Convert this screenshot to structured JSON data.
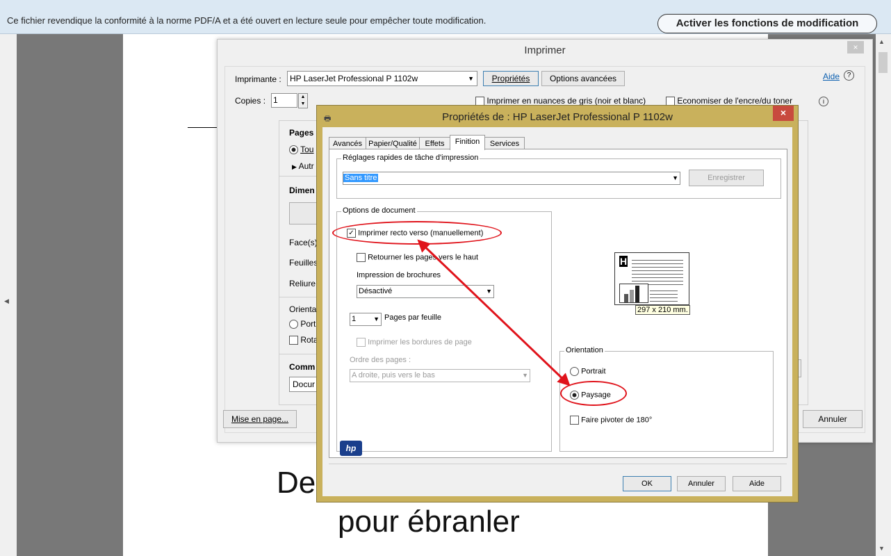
{
  "notice_bar": {
    "text": "Ce fichier revendique la conformité à la norme PDF/A et a été ouvert en lecture seule pour empêcher toute modification.",
    "enable_editing_button": "Activer les fonctions de modification"
  },
  "document": {
    "line1_fragment": "De",
    "line2": "pour ébranler"
  },
  "print_dialog": {
    "title": "Imprimer",
    "close_glyph": "×",
    "printer_label": "Imprimante :",
    "printer_value": "HP LaserJet Professional P 1102w",
    "properties_button": "Propriétés",
    "advanced_button": "Options avancées",
    "help_link": "Aide",
    "copies_label": "Copies :",
    "copies_value": "1",
    "grayscale_label": "Imprimer en nuances de gris (noir et blanc)",
    "save_ink_label": "Economiser de l'encre/du toner",
    "pages_header": "Pages à",
    "all_radio": "Tou",
    "more_options": "Autr",
    "size_header": "Dimen",
    "sides_label": "Face(s)",
    "sheets_label": "Feuilles",
    "binding_label": "Reliure",
    "orientation_header": "Orienta",
    "portrait_radio": "Port",
    "rotate_checkbox": "Rota",
    "comments_header": "Comm",
    "comments_select": "Docur",
    "page_setup_button": "Mise en page...",
    "cancel_button": "Annuler"
  },
  "properties_dialog": {
    "title": "Propriétés de : HP LaserJet Professional P 1102w",
    "close_glyph": "×",
    "tabs": [
      {
        "label": "Avancés"
      },
      {
        "label": "Papier/Qualité"
      },
      {
        "label": "Effets"
      },
      {
        "label": "Finition"
      },
      {
        "label": "Services"
      }
    ],
    "quick_settings_title": "Réglages rapides de tâche d'impression",
    "quick_settings_value": "Sans titre",
    "save_button": "Enregistrer",
    "document_options_title": "Options de document",
    "duplex_label": "Imprimer recto verso (manuellement)",
    "flip_label": "Retourner les pages vers le haut",
    "booklet_label": "Impression de brochures",
    "booklet_value": "Désactivé",
    "pages_per_sheet_value": "1",
    "pages_per_sheet_label": "Pages par feuille",
    "print_borders_label": "Imprimer les bordures de page",
    "page_order_label": "Ordre des pages :",
    "page_order_value": "A droite, puis vers le bas",
    "paper_size": "297 x 210 mm.",
    "orientation_title": "Orientation",
    "portrait_label": "Portrait",
    "landscape_label": "Paysage",
    "rotate_label": "Faire pivoter de 180°",
    "hp_logo": "hp",
    "ok_button": "OK",
    "cancel_button": "Annuler",
    "help_button": "Aide"
  },
  "annotations": {
    "color": "#e0131b"
  }
}
